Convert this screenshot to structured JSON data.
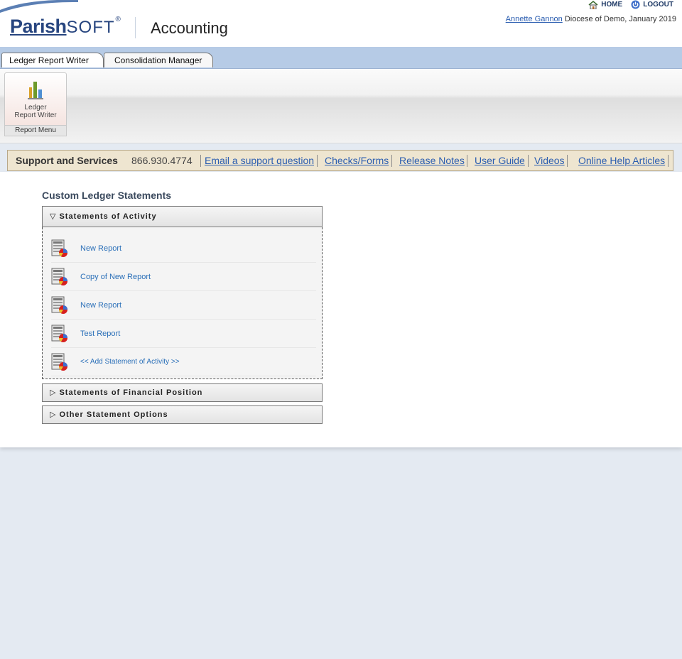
{
  "header": {
    "logo_parish": "Parish",
    "logo_soft": "SOFT",
    "logo_tm": "®",
    "app_title": "Accounting",
    "home_label": "HOME",
    "logout_label": "LOGOUT",
    "user_name": "Annette Gannon",
    "user_context": " Diocese of Demo, January 2019"
  },
  "tabs": [
    {
      "label": "Ledger Report Writer",
      "active": true
    },
    {
      "label": "Consolidation Manager",
      "active": false
    }
  ],
  "ribbon": {
    "button_line1": "Ledger",
    "button_line2": "Report Writer",
    "group_label": "Report Menu"
  },
  "support": {
    "title": "Support and Services",
    "phone": "866.930.4774",
    "links": [
      "Email a support question",
      "Checks/Forms",
      "Release Notes",
      "User Guide",
      "Videos",
      "Online Help Articles"
    ]
  },
  "main": {
    "section_title": "Custom Ledger Statements",
    "accordions": [
      {
        "label": "Statements of Activity",
        "expanded": true
      },
      {
        "label": "Statements of Financial Position",
        "expanded": false
      },
      {
        "label": "Other Statement Options",
        "expanded": false
      }
    ],
    "reports": [
      "New Report",
      "Copy of New Report",
      "New Report",
      "Test Report"
    ],
    "add_label": "<< Add Statement of Activity >>"
  },
  "colors": {
    "tab_bar": "#b6cbe6",
    "support_bg": "#eee5d0",
    "link": "#2a6fb8",
    "page_bg": "#e4eaf2"
  },
  "icons": {
    "home": "home-icon",
    "logout": "power-icon",
    "ribbon": "bar-chart-icon",
    "report": "report-sheet-icon",
    "expanded": "triangle-down-icon",
    "collapsed": "triangle-right-icon"
  }
}
